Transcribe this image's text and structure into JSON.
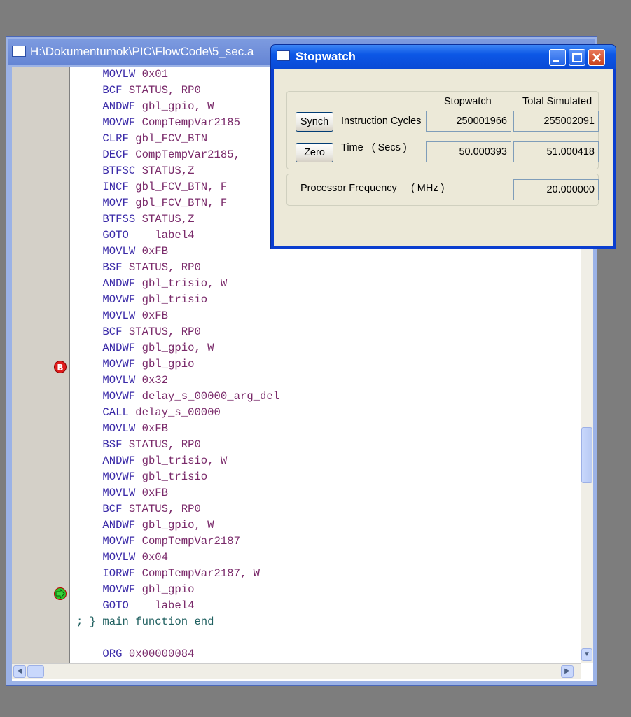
{
  "source_window": {
    "title": "H:\\Dokumentumok\\PIC\\FlowCode\\5_sec.a",
    "breakpoint_marker": "B",
    "breakpoint_icon": "breakpoint-icon",
    "pc_icon": "current-line-arrow-icon",
    "code_lines": [
      {
        "op": "    MOVLW",
        "args": " 0x01"
      },
      {
        "op": "    BCF",
        "args": " STATUS, RP0"
      },
      {
        "op": "    ANDWF",
        "args": " gbl_gpio, W"
      },
      {
        "op": "    MOVWF",
        "args": " CompTempVar2185"
      },
      {
        "op": "    CLRF",
        "args": " gbl_FCV_BTN"
      },
      {
        "op": "    DECF",
        "args": " CompTempVar2185,"
      },
      {
        "op": "    BTFSC",
        "args": " STATUS,Z"
      },
      {
        "op": "    INCF",
        "args": " gbl_FCV_BTN, F"
      },
      {
        "op": "    MOVF",
        "args": " gbl_FCV_BTN, F"
      },
      {
        "op": "    BTFSS",
        "args": " STATUS,Z"
      },
      {
        "op": "    GOTO",
        "args": "    label4"
      },
      {
        "op": "    MOVLW",
        "args": " 0xFB"
      },
      {
        "op": "    BSF",
        "args": " STATUS, RP0"
      },
      {
        "op": "    ANDWF",
        "args": " gbl_trisio, W"
      },
      {
        "op": "    MOVWF",
        "args": " gbl_trisio"
      },
      {
        "op": "    MOVLW",
        "args": " 0xFB"
      },
      {
        "op": "    BCF",
        "args": " STATUS, RP0"
      },
      {
        "op": "    ANDWF",
        "args": " gbl_gpio, W"
      },
      {
        "op": "    MOVWF",
        "args": " gbl_gpio"
      },
      {
        "op": "    MOVLW",
        "args": " 0x32"
      },
      {
        "op": "    MOVWF",
        "args": " delay_s_00000_arg_del"
      },
      {
        "op": "    CALL",
        "args": " delay_s_00000"
      },
      {
        "op": "    MOVLW",
        "args": " 0xFB"
      },
      {
        "op": "    BSF",
        "args": " STATUS, RP0"
      },
      {
        "op": "    ANDWF",
        "args": " gbl_trisio, W"
      },
      {
        "op": "    MOVWF",
        "args": " gbl_trisio"
      },
      {
        "op": "    MOVLW",
        "args": " 0xFB"
      },
      {
        "op": "    BCF",
        "args": " STATUS, RP0"
      },
      {
        "op": "    ANDWF",
        "args": " gbl_gpio, W"
      },
      {
        "op": "    MOVWF",
        "args": " CompTempVar2187"
      },
      {
        "op": "    MOVLW",
        "args": " 0x04"
      },
      {
        "op": "    IORWF",
        "args": " CompTempVar2187, W"
      },
      {
        "op": "    MOVWF",
        "args": " gbl_gpio"
      },
      {
        "op": "    GOTO",
        "args": "    label4"
      },
      {
        "comment": "; } main function end"
      },
      {
        "op": "",
        "args": ""
      },
      {
        "op": "    ORG",
        "args": " 0x00000084"
      }
    ]
  },
  "stopwatch": {
    "title": "Stopwatch",
    "minimize_icon": "minimize-icon",
    "maximize_icon": "maximize-icon",
    "close_icon": "close-icon",
    "col_stopwatch": "Stopwatch",
    "col_total": "Total Simulated",
    "synch_label": "Synch",
    "zero_label": "Zero",
    "instr_label": "Instruction  Cycles",
    "time_label": "Time   ( Secs )",
    "instr_stopwatch": "250001966",
    "instr_total": "255002091",
    "time_stopwatch": "50.000393",
    "time_total": "51.000418",
    "freq_label": "Processor Frequency     ( MHz )",
    "freq_value": "20.000000"
  }
}
